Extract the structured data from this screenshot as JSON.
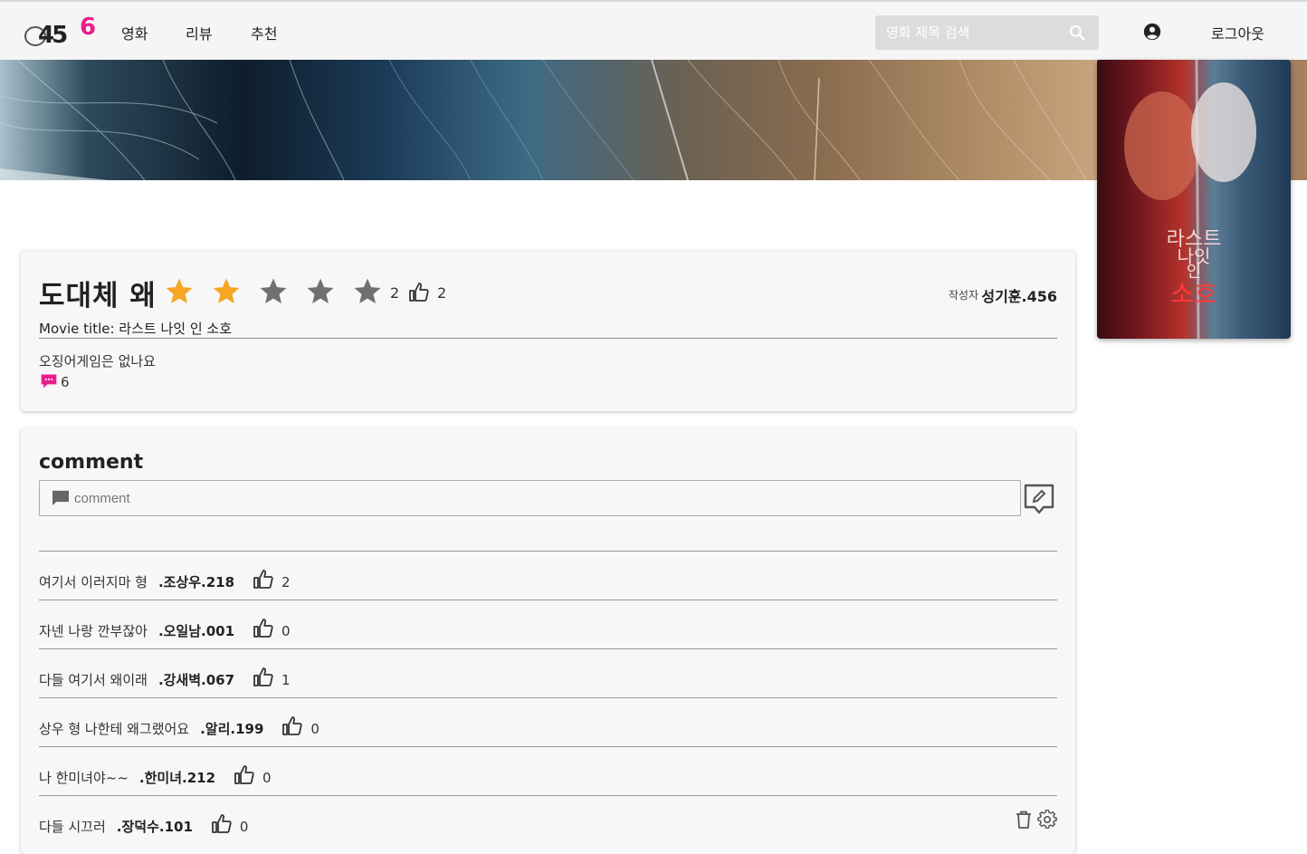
{
  "header": {
    "logo_text": "456",
    "nav": [
      {
        "label": "영화"
      },
      {
        "label": "리뷰"
      },
      {
        "label": "추천"
      }
    ],
    "search_placeholder": "영화 제목 검색",
    "logout_label": "로그아웃"
  },
  "poster": {
    "title_lines": [
      "라스트",
      "나잇",
      "인",
      "소호"
    ]
  },
  "review": {
    "title": "도대체 왜",
    "rating": 2,
    "rating_max": 5,
    "rating_label": "2",
    "likes": "2",
    "author_label": "작성자",
    "author": "성기훈.456",
    "movie_title": "Movie title: 라스트 나잇 인 소호",
    "body": "오징어게임은 없나요",
    "comment_count": "6"
  },
  "comments": {
    "heading": "comment",
    "input_placeholder": "comment",
    "items": [
      {
        "text": "여기서 이러지마 형",
        "author": ".조상우.218",
        "likes": "2"
      },
      {
        "text": "자넨 나랑 깐부잖아",
        "author": ".오일남.001",
        "likes": "0"
      },
      {
        "text": "다들 여기서 왜이래",
        "author": ".강새벽.067",
        "likes": "1"
      },
      {
        "text": "상우 형 나한테 왜그랬어요",
        "author": ".알리.199",
        "likes": "0"
      },
      {
        "text": "나 한미녀야~~",
        "author": ".한미녀.212",
        "likes": "0"
      },
      {
        "text": "다들 시끄러",
        "author": ".장덕수.101",
        "likes": "0",
        "owner": true
      }
    ]
  },
  "colors": {
    "star_filled": "#f5a623",
    "star_empty": "#707070",
    "accent_pink": "#e91e8c"
  }
}
